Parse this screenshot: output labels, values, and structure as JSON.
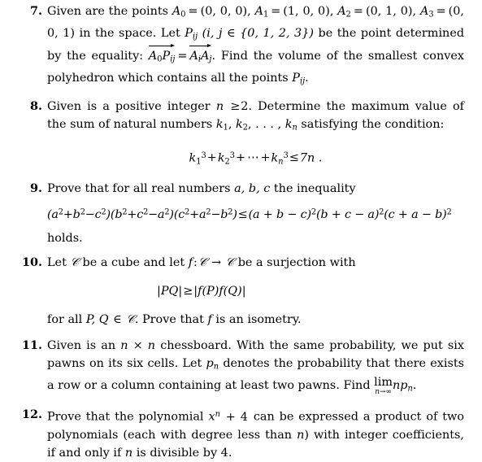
{
  "document": {
    "kind": "mathematics-problem-set",
    "background_color": "#ffffff",
    "text_color": "#000000",
    "problems": [
      {
        "number": "7.",
        "text": "Given are the points A_0 = (0,0,0), A_1 = (1,0,0), A_2 = (0,1,0), A_3 = (0,0,1) in the space. Let P_ij (i,j ∈ {0,1,2,3}) be the point determined by the equality: vec(A_0 P_ij) = vec(A_i A_j). Find the volume of the smallest convex polyhedron which contains all the points P_ij.",
        "parts": {
          "lead": "Given are the points",
          "point_0_label": "A",
          "point_0_index": "0",
          "point_0_value": "(0, 0, 0)",
          "point_1_label": "A",
          "point_1_index": "1",
          "point_1_value": "(1, 0, 0)",
          "point_2_label": "A",
          "point_2_index": "2",
          "point_2_value": "(0, 1, 0)",
          "point_3_label": "A",
          "point_3_index": "3",
          "point_3_value": "(0, 0, 1)",
          "after_points": "in the space. Let",
          "P_label": "P",
          "P_index": "ij",
          "index_cond": "(i, j ∈ {0, 1, 2, 3})",
          "after_P": "be the point determined",
          "by_equality": "by the equality:",
          "vec_lhs": "A₀Pᵢⱼ",
          "vec_rhs": "AᵢAⱼ",
          "tail": "Find the volume of the smallest convex",
          "last_line": "polyhedron which contains all the points",
          "last_symbol": "P",
          "last_symbol_index": "ij"
        }
      },
      {
        "number": "8.",
        "text": "Given is a positive integer n ≥ 2. Determine the maximum value of the sum of natural numbers k_1, k_2, ..., k_n satisfying the condition: k_1^3 + k_2^3 + ... + k_n^3 ≤ 7n.",
        "parts": {
          "line1_a": "Given is a positive integer",
          "line1_var": "n",
          "line1_rel": "≥",
          "line1_val": "2",
          "line1_b": "Determine the maximum value of the",
          "line2_a": "sum of natural numbers",
          "line2_k1": "k",
          "line2_k1_sub": "1",
          "line2_k2": "k",
          "line2_k2_sub": "2",
          "line2_dots": ",  . . . ,",
          "line2_kn": "k",
          "line2_kn_sub": "n",
          "line2_b": "satisfying the condition:"
        },
        "display": {
          "latex": "k_1^3 + k_2^3 + \\cdots + k_n^3 \\le 7n .",
          "terms": [
            "k₁³",
            "k₂³",
            "⋯",
            "kₙ³"
          ],
          "relation": "≤",
          "rhs": "7n ."
        }
      },
      {
        "number": "9.",
        "text": "Prove that for all real numbers a, b, c the inequality (a^2+b^2-c^2)(b^2+c^2-a^2)(c^2+a^2-b^2) ≤ (a+b-c)^2(b+c-a)^2(c+a-b)^2 holds.",
        "parts": {
          "line1_a": "Prove that for all real numbers",
          "line1_vars": "a, b, c",
          "line1_b": "the inequality",
          "holds": "holds."
        },
        "display": {
          "latex": "(a^2+b^2-c^2)(b^2+c^2-a^2)(c^2+a^2-b^2) \\le (a+b-c)^2(b+c-a)^2(c+a-b)^2",
          "lhs_factors": [
            "(a²+b²−c²)",
            "(b²+c²−a²)",
            "(c²+a²−b²)"
          ],
          "relation": "≤",
          "rhs_factors": [
            "(a + b − c)²",
            "(b + c − a)²",
            "(c + a − b)²"
          ]
        }
      },
      {
        "number": "10.",
        "text": "Let C be a cube and let f: C → C be a surjection with |PQ| ≥ |f(P)f(Q)| for all P,Q ∈ C. Prove that f is an isometry.",
        "parts": {
          "line1_a": "Let",
          "cube_symbol": "𝒞",
          "line1_b": "be a cube and let",
          "map": "f",
          "map_rel": ":",
          "map_to": "→",
          "line1_c": "be a surjection with",
          "line3_a": "for all",
          "line3_pq": "P, Q",
          "line3_in": "∈",
          "line3_b": "Prove that",
          "line3_f": "f",
          "line3_c": "is an isometry."
        },
        "display": {
          "latex": "|PQ| \\ge |f(P)f(Q)|",
          "lhs": "|PQ|",
          "relation": "≥",
          "rhs": "|f(P)f(Q)|"
        }
      },
      {
        "number": "11.",
        "text": "Given is an n × n chessboard. With the same probability, we put six pawns on its six cells. Let p_n denotes the probability that there exists a row or a column containing at least two pawns. Find lim_{n→∞} n p_n.",
        "parts": {
          "line1_a": "Given is an",
          "line1_dim": "n × n",
          "line1_b": "chessboard.  With the same probability, we put six",
          "line2_a": "pawns on its six cells. Let",
          "line2_p": "p",
          "line2_p_sub": "n",
          "line2_b": "denotes the probability that there exists a",
          "line3_a": "row or a column containing at least two pawns. Find",
          "limit_op": "lim",
          "limit_sub": "n→∞",
          "limit_expr": "np",
          "limit_expr_sub": "n",
          "period": "."
        }
      },
      {
        "number": "12.",
        "text": "Prove that the polynomial x^n + 4 can be expressed a product of two polynomials (each with degree less than n) with integer coefficients, if and only if n is divisible by 4.",
        "parts": {
          "line1_a": "Prove that the polynomial",
          "poly_base": "x",
          "poly_exp": "n",
          "poly_tail": "+ 4",
          "line1_b": "can be expressed a product of two",
          "line2_a": "polynomials (each with degree less than",
          "line2_var": "n",
          "line2_b": ") with integer coefficients, if",
          "line3_a": "and only if",
          "line3_var": "n",
          "line3_b": "is divisible by 4."
        }
      }
    ]
  }
}
